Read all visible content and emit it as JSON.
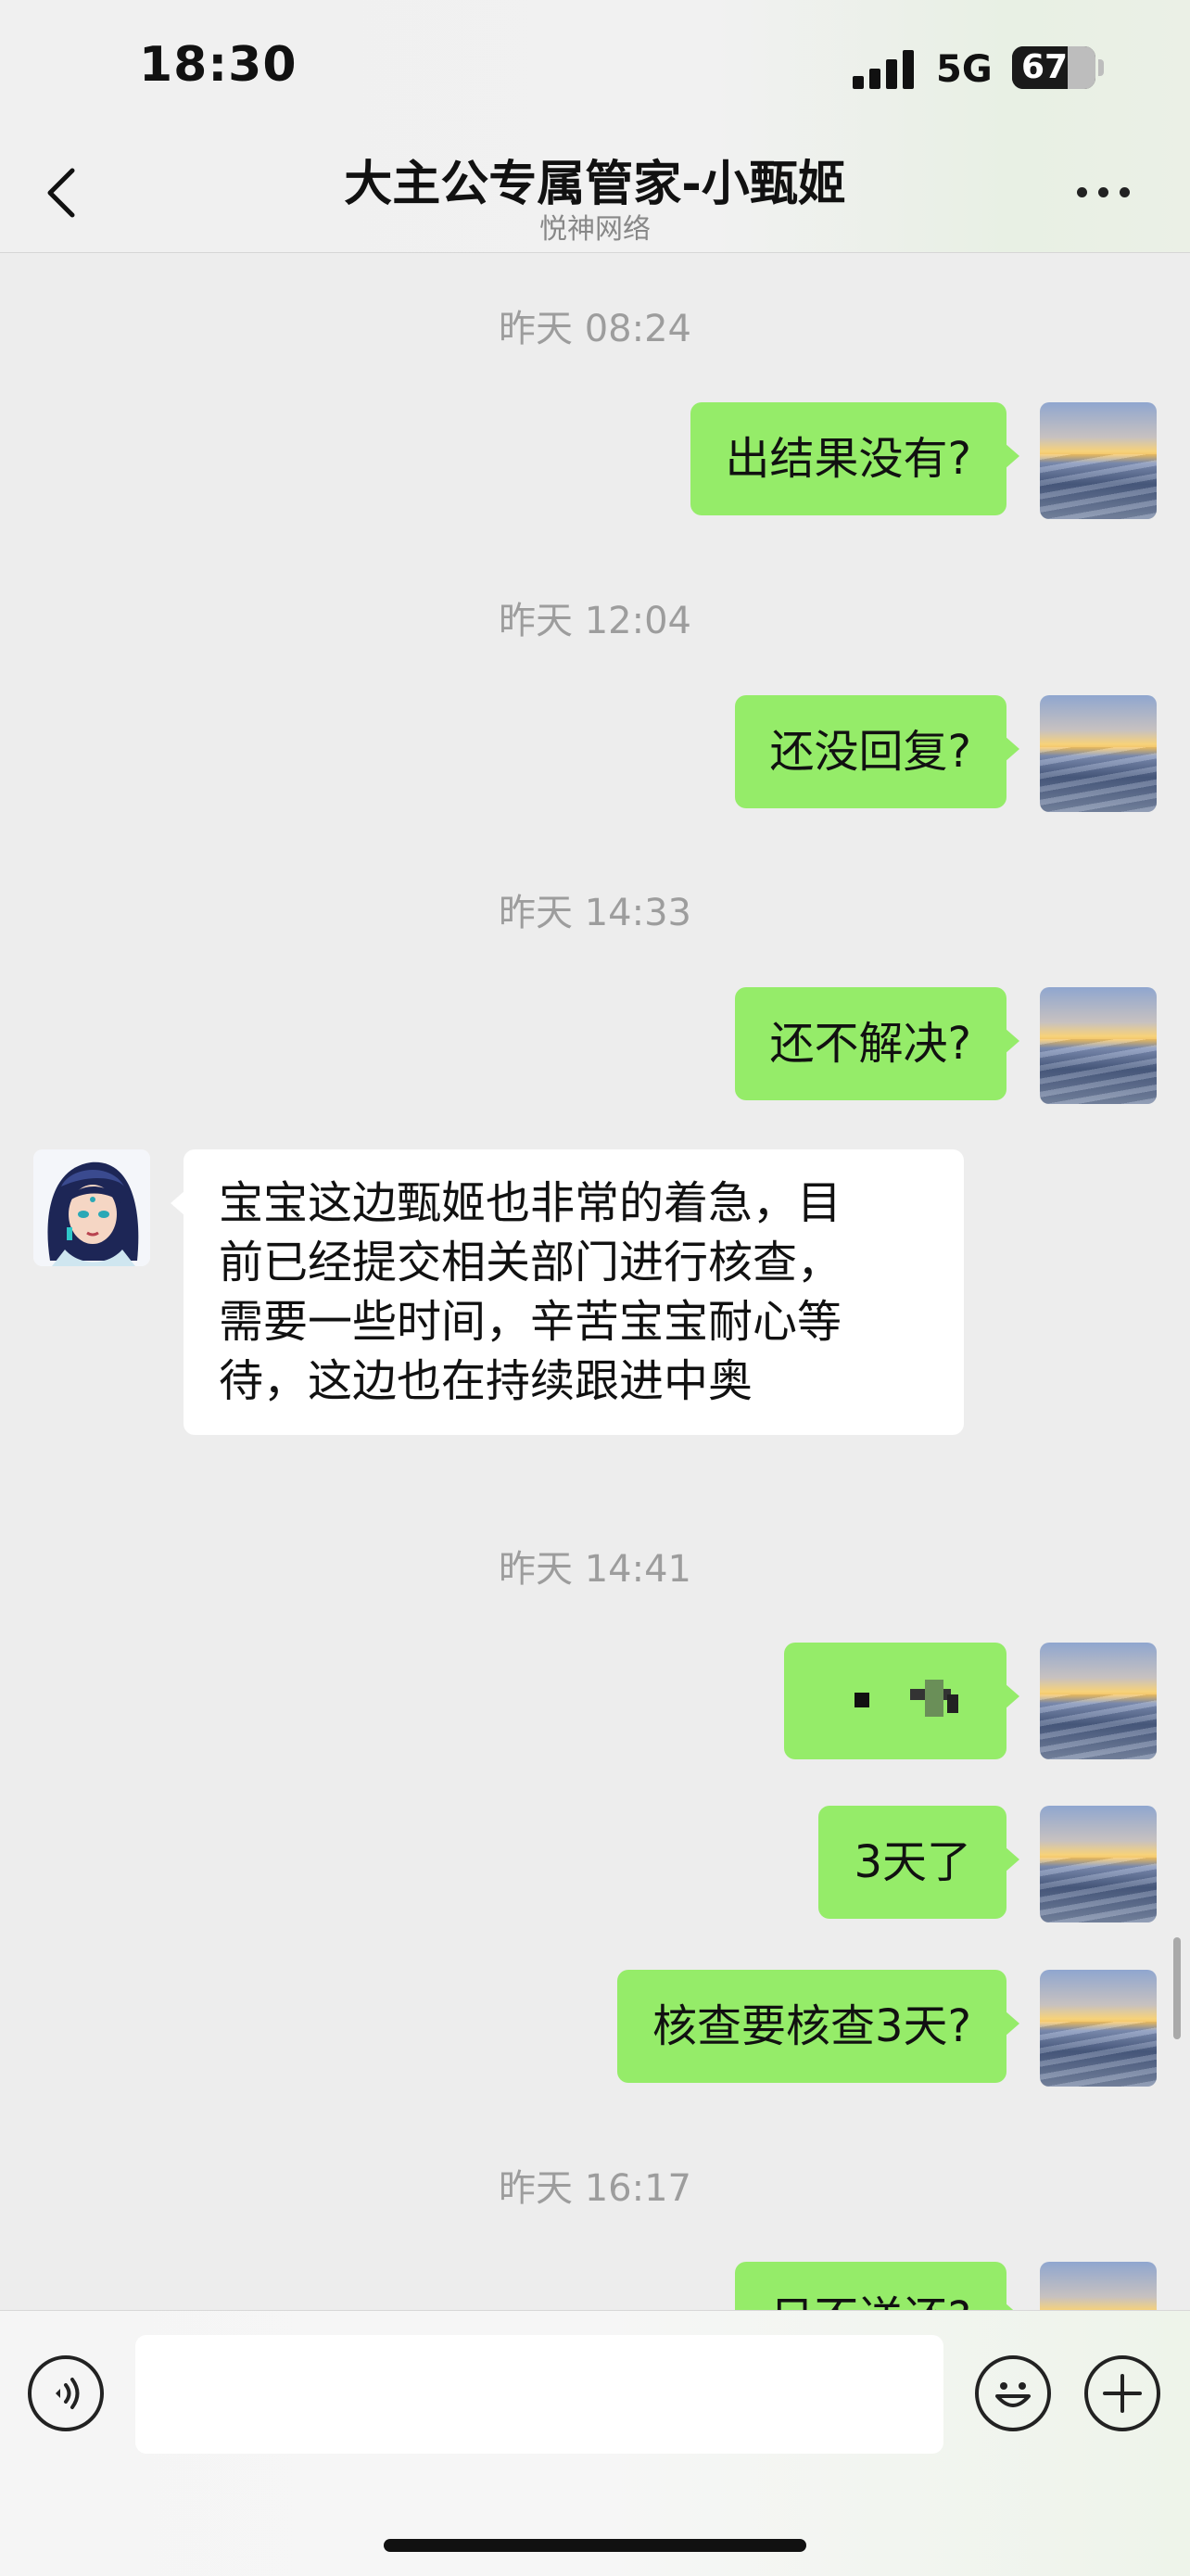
{
  "status_bar": {
    "time": "18:30",
    "network": "5G",
    "battery_level": "67",
    "battery_fraction": 0.67
  },
  "header": {
    "title": "大主公专属管家-小甄姬",
    "subtitle": "悦神网络",
    "back_icon": "chevron-left-icon",
    "more_icon": "ellipsis-icon"
  },
  "messages": [
    {
      "type": "timestamp",
      "text": "昨天 08:24"
    },
    {
      "type": "sent",
      "text": "出结果没有?"
    },
    {
      "type": "timestamp",
      "text": "昨天 12:04"
    },
    {
      "type": "sent",
      "text": "还没回复?"
    },
    {
      "type": "timestamp",
      "text": "昨天 14:33"
    },
    {
      "type": "sent",
      "text": "还不解决?"
    },
    {
      "type": "received",
      "lines": [
        "宝宝这边甄姬也非常的着急，目",
        "前已经提交相关部门进行核查，",
        "需要一些时间，辛苦宝宝耐心等",
        "待，这边也在持续跟进中奥"
      ]
    },
    {
      "type": "timestamp",
      "text": "昨天 14:41"
    },
    {
      "type": "sent-redacted",
      "text": ""
    },
    {
      "type": "sent",
      "text": "3天了"
    },
    {
      "type": "sent",
      "text": "核查要核查3天?"
    },
    {
      "type": "timestamp",
      "text": "昨天 16:17"
    },
    {
      "type": "sent",
      "text": "日不送还?"
    }
  ],
  "input": {
    "placeholder": "",
    "voice_icon": "voice-icon",
    "emoji_icon": "emoji-icon",
    "plus_icon": "plus-icon"
  },
  "colors": {
    "sent_bubble": "#95ec69",
    "received_bubble": "#ffffff",
    "background": "#ededed"
  }
}
